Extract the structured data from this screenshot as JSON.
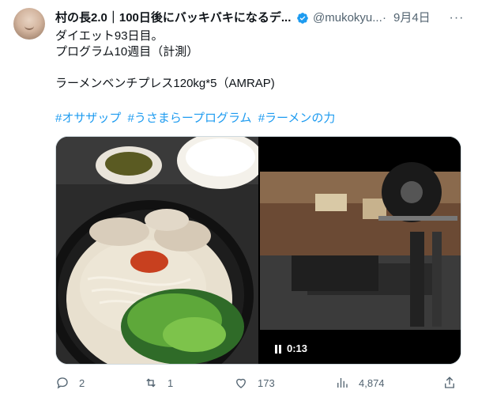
{
  "tweet": {
    "author_name": "村の長2.0｜100日後にバッキバキになるデ...",
    "handle": "@mukokyu...",
    "date": "9月4日",
    "more": "···",
    "lines": [
      "ダイエット93日目。",
      "プログラム10週目（計測）",
      "ラーメンベンチプレス120kg*5（AMRAP)"
    ],
    "hashtags": [
      "#オサザップ",
      "#うさまらープログラム",
      "#ラーメンの力"
    ],
    "video_duration": "0:13"
  },
  "actions": {
    "replies": "2",
    "retweets": "1",
    "likes": "173",
    "views": "4,874"
  },
  "colors": {
    "link": "#1d9bf0",
    "verified": "#1d9bf0",
    "muted": "#536471"
  },
  "icons": [
    "verified-badge-icon",
    "reply-icon",
    "retweet-icon",
    "like-icon",
    "views-icon",
    "share-icon",
    "pause-icon"
  ]
}
